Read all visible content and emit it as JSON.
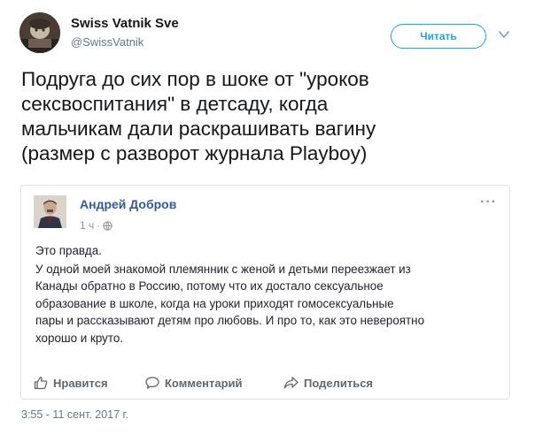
{
  "header": {
    "display_name": "Swiss Vatnik Sve",
    "handle": "@SwissVatnik",
    "follow_label": "Читать"
  },
  "tweet": {
    "lines": [
      "Подруга до сих пор в шоке от \"уроков",
      "сексвоспитания\" в детсаду, когда",
      "мальчикам дали раскрашивать вагину",
      "(размер с разворот журнала Playboy)"
    ],
    "timestamp": "3:55 - 11 сент. 2017 г."
  },
  "embedded_post": {
    "author": "Андрей Добров",
    "time": "1 ч",
    "more": "···",
    "paragraphs": [
      "Это правда.",
      "У одной моей знакомой племянник с женой и детьми переезжает из",
      "Канады обратно в Россию, потому что их достало сексуальное",
      "образование в школе, когда на уроки приходят гомосексуальные",
      "пары и рассказывают детям про любовь. И про то, как это невероятно",
      "хорошо и круто."
    ],
    "actions": {
      "like": "Нравится",
      "comment": "Комментарий",
      "share": "Поделиться"
    }
  },
  "colors": {
    "accent": "#1da1f2",
    "facebook_name": "#365899",
    "muted": "#657786"
  },
  "icons": [
    "user-avatar-icon",
    "chevron-down-icon",
    "globe-icon",
    "like-thumb-icon",
    "comment-bubble-icon",
    "share-arrow-icon"
  ]
}
